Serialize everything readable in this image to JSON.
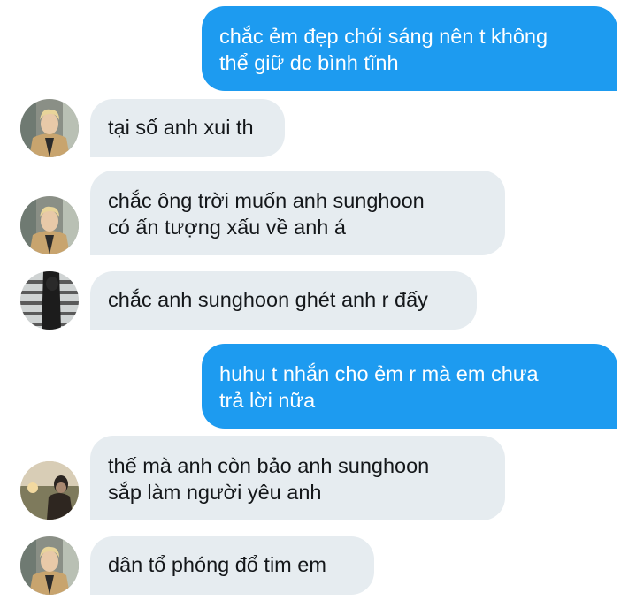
{
  "messages": [
    {
      "direction": "sent",
      "lines": [
        "chắc ẻm đẹp chói sáng nên t không",
        "thể giữ dc bình tĩnh"
      ]
    },
    {
      "direction": "received",
      "avatar": "avatar-blond-suit",
      "lines": [
        "tại số anh xui th"
      ]
    },
    {
      "direction": "received",
      "avatar": "avatar-blond-suit",
      "lines": [
        "chắc ông trời muốn anh sunghoon",
        "có ấn tượng xấu về anh á"
      ]
    },
    {
      "direction": "received",
      "avatar": "avatar-dark-window",
      "lines": [
        "chắc anh sunghoon ghét anh r đấy"
      ]
    },
    {
      "direction": "sent",
      "lines": [
        "huhu t nhắn cho ẻm r mà em chưa",
        "trả lời nữa"
      ]
    },
    {
      "direction": "received",
      "avatar": "avatar-sunset-portrait",
      "lines": [
        "thế mà anh còn bảo anh sunghoon",
        "sắp làm người yêu anh"
      ]
    },
    {
      "direction": "received",
      "avatar": "avatar-blond-suit",
      "lines": [
        "dân tổ phóng đổ tim em"
      ]
    }
  ],
  "colors": {
    "sent_bubble": "#1d9bf0",
    "received_bubble": "#e6ecf0",
    "sent_text": "#ffffff",
    "received_text": "#14171a"
  }
}
